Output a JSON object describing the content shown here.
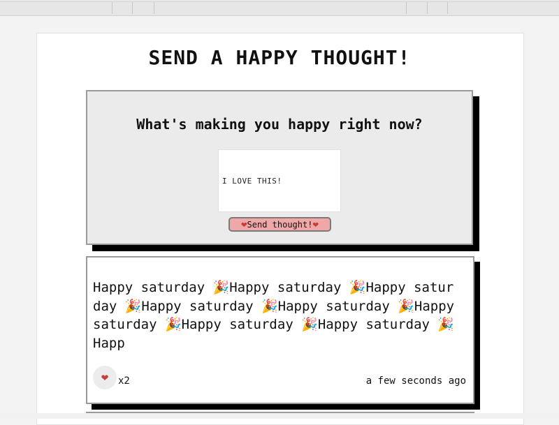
{
  "page": {
    "title": "SEND A HAPPY THOUGHT!"
  },
  "form": {
    "question": "What's making you happy right now?",
    "input_value": "I LOVE THIS!",
    "send_label": "Send thought!",
    "button_color": "#f0a7a7",
    "heart_icon": "heart-icon"
  },
  "thought": {
    "message": "Happy saturday 🎉Happy saturday 🎉Happy saturday 🎉Happy saturday 🎉Happy saturday 🎉Happy saturday 🎉Happy saturday 🎉Happy saturday 🎉Happ",
    "like_count": "x2",
    "timestamp": "a few seconds ago"
  },
  "colors": {
    "heart": "#c43c3c",
    "shadow": "#000000",
    "card_background": "#ebebeb"
  }
}
